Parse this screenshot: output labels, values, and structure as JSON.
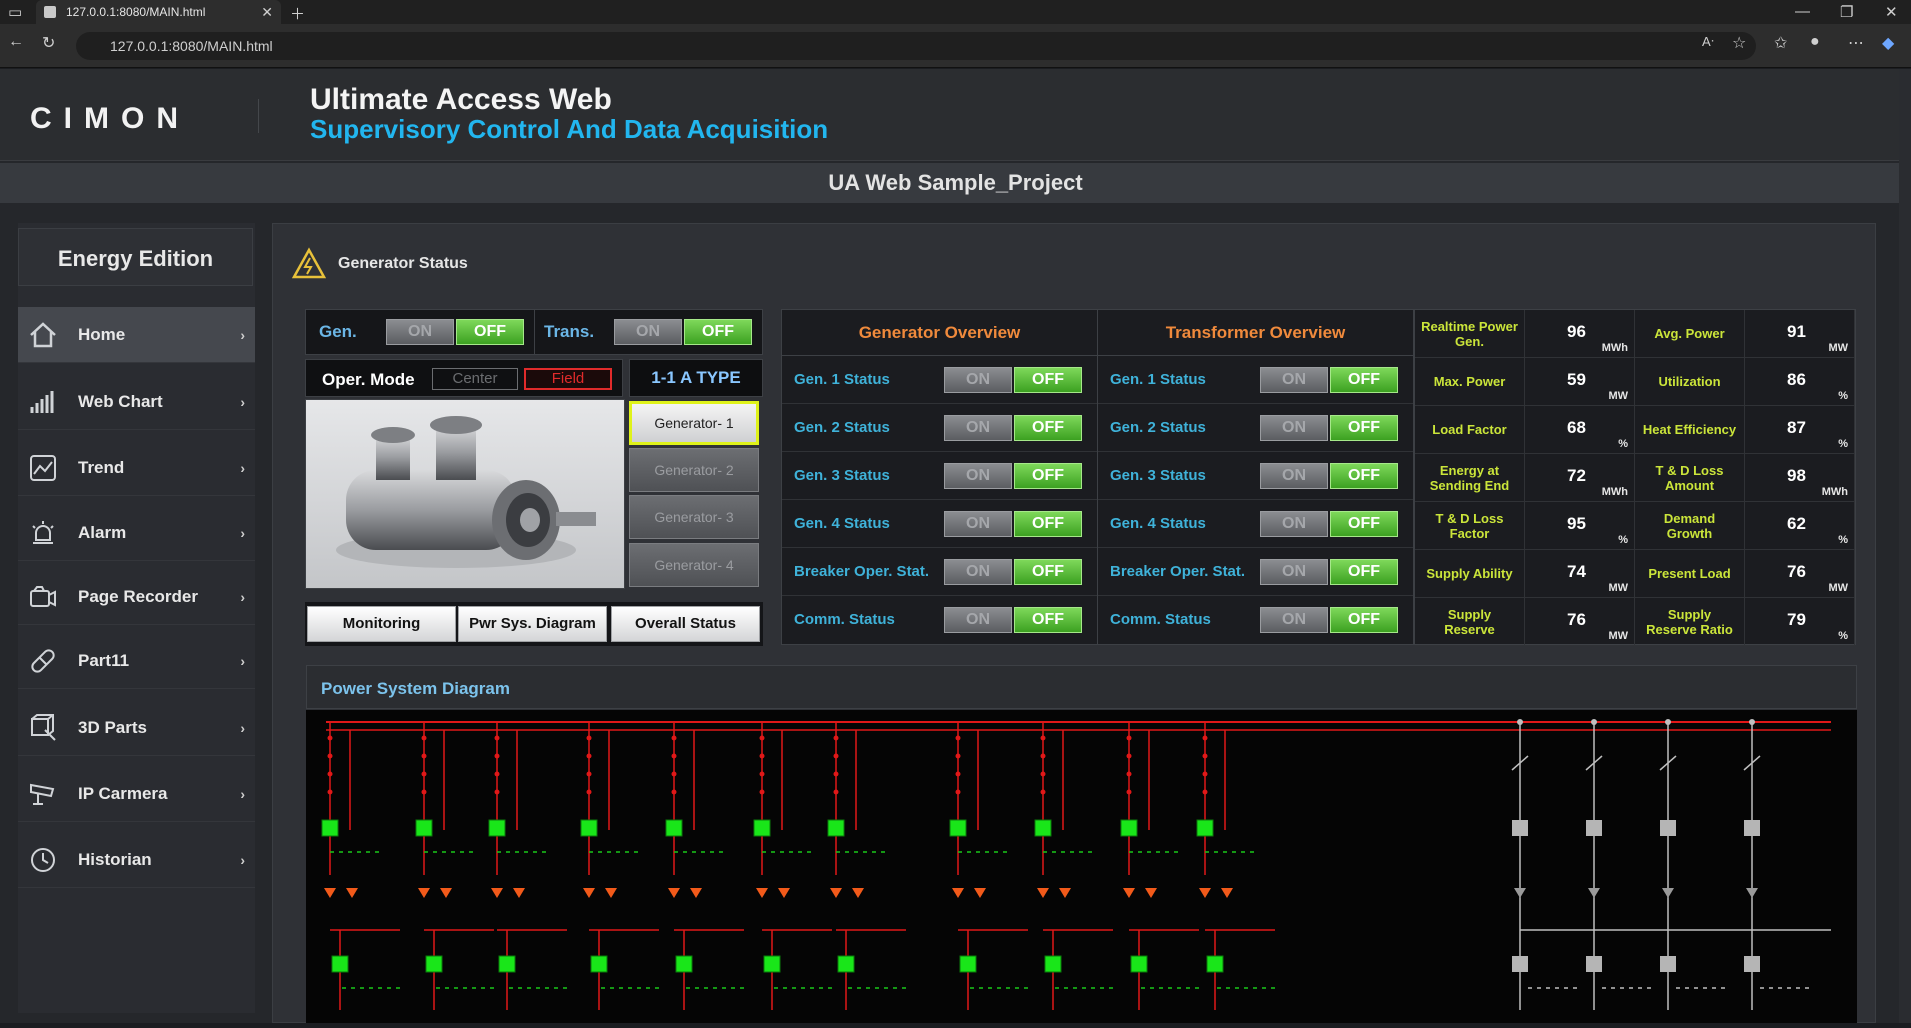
{
  "browser": {
    "tab_title": "127.0.0.1:8080/MAIN.html",
    "url": "127.0.0.1:8080/MAIN.html"
  },
  "header": {
    "logo": "CIMON",
    "title": "Ultimate Access Web",
    "subtitle": "Supervisory Control And Data Acquisition",
    "project": "UA Web Sample_Project"
  },
  "sidebar": {
    "edition": "Energy Edition",
    "items": [
      {
        "label": "Home",
        "icon": "home-icon"
      },
      {
        "label": "Web Chart",
        "icon": "bar-chart-icon"
      },
      {
        "label": "Trend",
        "icon": "trend-icon"
      },
      {
        "label": "Alarm",
        "icon": "alarm-icon"
      },
      {
        "label": "Page Recorder",
        "icon": "camera-icon"
      },
      {
        "label": "Part11",
        "icon": "pill-icon"
      },
      {
        "label": "3D Parts",
        "icon": "cube-icon"
      },
      {
        "label": "IP Carmera",
        "icon": "ip-camera-icon"
      },
      {
        "label": "Historian",
        "icon": "history-icon"
      }
    ]
  },
  "main": {
    "title": "Generator Status",
    "gen_label": "Gen.",
    "trans_label": "Trans.",
    "on": "ON",
    "off": "OFF",
    "oper_mode": "Oper. Mode",
    "mode_center": "Center",
    "mode_field": "Field",
    "type": "1-1 A TYPE",
    "generators": [
      "Generator- 1",
      "Generator- 2",
      "Generator- 3",
      "Generator- 4"
    ],
    "bottom_buttons": [
      "Monitoring",
      "Pwr Sys. Diagram",
      "Overall Status"
    ]
  },
  "generator_overview": {
    "title": "Generator Overview",
    "rows": [
      "Gen. 1 Status",
      "Gen. 2 Status",
      "Gen. 3 Status",
      "Gen. 4 Status",
      "Breaker Oper. Stat.",
      "Comm. Status"
    ]
  },
  "transformer_overview": {
    "title": "Transformer Overview",
    "rows": [
      "Gen. 1 Status",
      "Gen. 2 Status",
      "Gen. 3 Status",
      "Gen. 4 Status",
      "Breaker Oper. Stat.",
      "Comm. Status"
    ]
  },
  "kpi": [
    {
      "label": "Realtime Power Gen.",
      "value": "96",
      "unit": "MWh"
    },
    {
      "label": "Avg. Power",
      "value": "91",
      "unit": "MW"
    },
    {
      "label": "Max. Power",
      "value": "59",
      "unit": "MW"
    },
    {
      "label": "Utilization",
      "value": "86",
      "unit": "%"
    },
    {
      "label": "Load Factor",
      "value": "68",
      "unit": "%"
    },
    {
      "label": "Heat Efficiency",
      "value": "87",
      "unit": "%"
    },
    {
      "label": "Energy at Sending End",
      "value": "72",
      "unit": "MWh"
    },
    {
      "label": "T & D Loss Amount",
      "value": "98",
      "unit": "MWh"
    },
    {
      "label": "T & D Loss Factor",
      "value": "95",
      "unit": "%"
    },
    {
      "label": "Demand Growth",
      "value": "62",
      "unit": "%"
    },
    {
      "label": "Supply Ability",
      "value": "74",
      "unit": "MW"
    },
    {
      "label": "Present Load",
      "value": "76",
      "unit": "MW"
    },
    {
      "label": "Supply Reserve",
      "value": "76",
      "unit": "MW"
    },
    {
      "label": "Supply Reserve Ratio",
      "value": "79",
      "unit": "%"
    }
  ],
  "diagram": {
    "title": "Power System Diagram"
  },
  "colors": {
    "accent_blue": "#22b6ef",
    "on_green": "#3ca121",
    "orange_header": "#f08a3c",
    "kpi_label": "#cbe53a",
    "line_red": "#e01818",
    "line_gray": "#bfbfbf"
  }
}
